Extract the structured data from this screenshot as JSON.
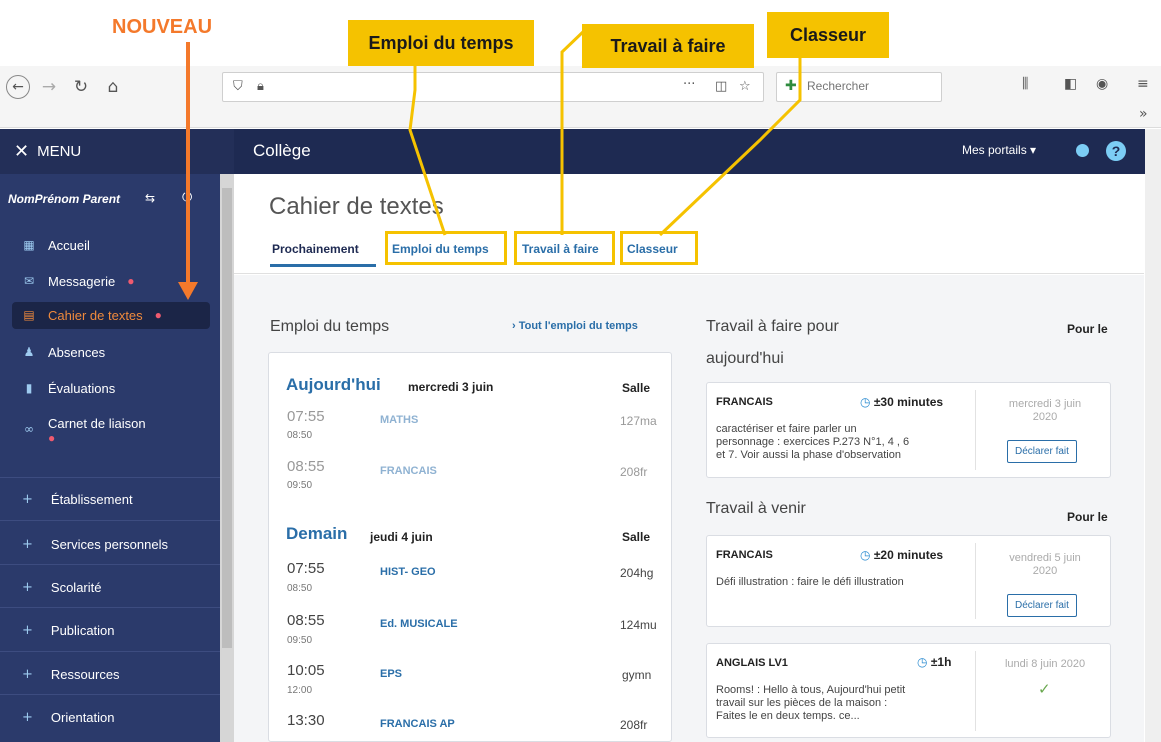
{
  "annotations": {
    "nouveau": "NOUVEAU",
    "emploi": "Emploi du temps",
    "travail": "Travail à faire",
    "classeur": "Classeur"
  },
  "browser": {
    "search_placeholder": "Rechercher",
    "more": "···",
    "overflow": "»"
  },
  "appbar": {
    "menu_label": "MENU",
    "school": "Collège",
    "portails": "Mes portails ▾"
  },
  "sidebar": {
    "user": "NomPrénom Parent",
    "items": [
      {
        "label": "Accueil",
        "icon": "grid-icon"
      },
      {
        "label": "Messagerie",
        "icon": "envelope-icon"
      },
      {
        "label": "Cahier de textes",
        "icon": "notebook-icon"
      },
      {
        "label": "Absences",
        "icon": "people-icon"
      },
      {
        "label": "Évaluations",
        "icon": "bar-chart-icon"
      },
      {
        "label": "Carnet de liaison",
        "icon": "link-icon"
      }
    ],
    "sections": [
      "Établissement",
      "Services personnels",
      "Scolarité",
      "Publication",
      "Ressources",
      "Orientation"
    ]
  },
  "page": {
    "title": "Cahier de textes",
    "tabs": [
      "Prochainement",
      "Emploi du temps",
      "Travail à faire",
      "Classeur"
    ]
  },
  "schedule": {
    "title": "Emploi du temps",
    "link_all": "› Tout l'emploi du temps",
    "salle": "Salle",
    "today": {
      "head": "Aujourd'hui",
      "date": "mercredi 3 juin",
      "rows": [
        {
          "start": "07:55",
          "end": "08:50",
          "subject": "MATHS",
          "room": "127ma"
        },
        {
          "start": "08:55",
          "end": "09:50",
          "subject": "FRANCAIS",
          "room": "208fr"
        }
      ]
    },
    "tomorrow": {
      "head": "Demain",
      "date": "jeudi 4 juin",
      "rows": [
        {
          "start": "07:55",
          "end": "08:50",
          "subject": "HIST- GEO",
          "room": "204hg"
        },
        {
          "start": "08:55",
          "end": "09:50",
          "subject": "Ed. MUSICALE",
          "room": "124mu"
        },
        {
          "start": "10:05",
          "end": "12:00",
          "subject": "EPS",
          "room": "gymn"
        },
        {
          "start": "13:30",
          "end": "",
          "subject": "FRANCAIS AP",
          "room": "208fr"
        }
      ]
    }
  },
  "homework": {
    "today_title_1": "Travail à faire pour",
    "today_title_2": "aujourd'hui",
    "pour_le": "Pour le",
    "upcoming_title": "Travail à venir",
    "declare": "Déclarer fait",
    "today_items": [
      {
        "subject": "FRANCAIS",
        "duration": "±30 minutes",
        "text_lines": [
          "caractériser et faire parler un",
          "personnage : exercices P.273 N°1, 4 , 6",
          "et 7. Voir aussi la phase d'observation"
        ],
        "date_1": "mercredi 3 juin",
        "date_2": "2020"
      }
    ],
    "upcoming_items": [
      {
        "subject": "FRANCAIS",
        "duration": "±20 minutes",
        "text_lines": [
          "Défi illustration : faire le défi illustration"
        ],
        "date_1": "vendredi 5 juin",
        "date_2": "2020"
      },
      {
        "subject": "ANGLAIS LV1",
        "duration": "±1h",
        "text_lines": [
          "Rooms! : Hello à tous, Aujourd'hui petit",
          "travail sur les pièces de la maison :",
          "Faites le en deux temps. ce..."
        ],
        "date_1": "lundi 8 juin 2020",
        "date_2": ""
      }
    ]
  },
  "colors": {
    "appbar": "#1e2a52",
    "sidebar": "#2b3a6b",
    "accent": "#2a6ea8",
    "active": "#f08a3c",
    "annotation": "#f5c200",
    "nouveau": "#f4792b"
  }
}
